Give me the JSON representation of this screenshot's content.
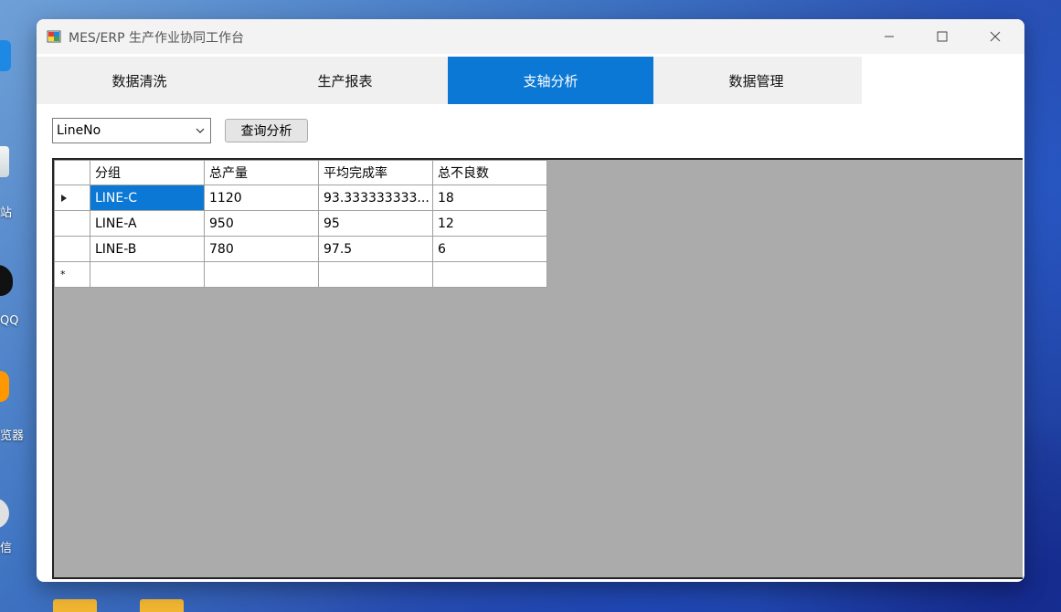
{
  "desktop": {
    "icons": [
      {
        "name": "desktop-icon-1",
        "label": "站"
      },
      {
        "name": "desktop-icon-qq",
        "label": "QQ"
      },
      {
        "name": "desktop-icon-browser",
        "label": "览器"
      },
      {
        "name": "desktop-icon-4",
        "label": "信"
      }
    ]
  },
  "window": {
    "title": "MES/ERP 生产作业协同工作台",
    "icon": "app-window-icon"
  },
  "tabs": [
    {
      "label": "数据清洗",
      "active": false
    },
    {
      "label": "生产报表",
      "active": false
    },
    {
      "label": "支轴分析",
      "active": true
    },
    {
      "label": "数据管理",
      "active": false
    }
  ],
  "toolbar": {
    "group_by_value": "LineNo",
    "query_button_label": "查询分析"
  },
  "grid": {
    "columns": [
      "分组",
      "总产量",
      "平均完成率",
      "总不良数"
    ],
    "rows": [
      {
        "current": true,
        "cells": [
          "LINE-C",
          "1120",
          "93.333333333...",
          "18"
        ]
      },
      {
        "current": false,
        "cells": [
          "LINE-A",
          "950",
          "95",
          "12"
        ]
      },
      {
        "current": false,
        "cells": [
          "LINE-B",
          "780",
          "97.5",
          "6"
        ]
      }
    ],
    "new_row_marker": "*"
  },
  "colors": {
    "accent": "#0a78d4",
    "grid_background": "#ababab"
  }
}
